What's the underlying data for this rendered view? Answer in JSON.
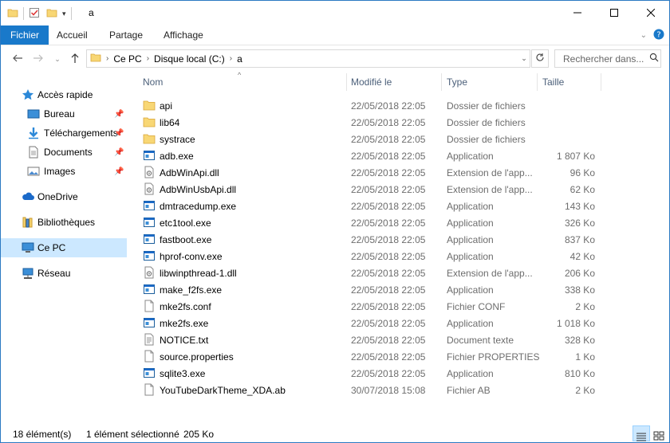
{
  "window": {
    "title": "a"
  },
  "ribbon": {
    "tabs": [
      "Fichier",
      "Accueil",
      "Partage",
      "Affichage"
    ]
  },
  "address": {
    "crumbs": [
      "Ce PC",
      "Disque local (C:)",
      "a"
    ]
  },
  "search": {
    "placeholder": "Rechercher dans..."
  },
  "sidebar": {
    "items": [
      {
        "label": "Accès rapide",
        "icon": "star-icon"
      },
      {
        "label": "Bureau",
        "icon": "desktop-icon",
        "pinned": true
      },
      {
        "label": "Téléchargements",
        "icon": "download-icon",
        "pinned": true
      },
      {
        "label": "Documents",
        "icon": "documents-icon",
        "pinned": true
      },
      {
        "label": "Images",
        "icon": "pictures-icon",
        "pinned": true
      },
      {
        "label": "OneDrive",
        "icon": "cloud-icon"
      },
      {
        "label": "Bibliothèques",
        "icon": "library-icon"
      },
      {
        "label": "Ce PC",
        "icon": "computer-icon",
        "selected": true
      },
      {
        "label": "Réseau",
        "icon": "network-icon"
      }
    ]
  },
  "columns": {
    "name": "Nom",
    "date": "Modifié le",
    "type": "Type",
    "size": "Taille"
  },
  "files": [
    {
      "name": "api",
      "date": "22/05/2018 22:05",
      "type": "Dossier de fichiers",
      "size": "",
      "icon": "folder"
    },
    {
      "name": "lib64",
      "date": "22/05/2018 22:05",
      "type": "Dossier de fichiers",
      "size": "",
      "icon": "folder"
    },
    {
      "name": "systrace",
      "date": "22/05/2018 22:05",
      "type": "Dossier de fichiers",
      "size": "",
      "icon": "folder"
    },
    {
      "name": "adb.exe",
      "date": "22/05/2018 22:05",
      "type": "Application",
      "size": "1 807 Ko",
      "icon": "exe"
    },
    {
      "name": "AdbWinApi.dll",
      "date": "22/05/2018 22:05",
      "type": "Extension de l'app...",
      "size": "96 Ko",
      "icon": "dll"
    },
    {
      "name": "AdbWinUsbApi.dll",
      "date": "22/05/2018 22:05",
      "type": "Extension de l'app...",
      "size": "62 Ko",
      "icon": "dll"
    },
    {
      "name": "dmtracedump.exe",
      "date": "22/05/2018 22:05",
      "type": "Application",
      "size": "143 Ko",
      "icon": "exe"
    },
    {
      "name": "etc1tool.exe",
      "date": "22/05/2018 22:05",
      "type": "Application",
      "size": "326 Ko",
      "icon": "exe"
    },
    {
      "name": "fastboot.exe",
      "date": "22/05/2018 22:05",
      "type": "Application",
      "size": "837 Ko",
      "icon": "exe"
    },
    {
      "name": "hprof-conv.exe",
      "date": "22/05/2018 22:05",
      "type": "Application",
      "size": "42 Ko",
      "icon": "exe"
    },
    {
      "name": "libwinpthread-1.dll",
      "date": "22/05/2018 22:05",
      "type": "Extension de l'app...",
      "size": "206 Ko",
      "icon": "dll"
    },
    {
      "name": "make_f2fs.exe",
      "date": "22/05/2018 22:05",
      "type": "Application",
      "size": "338 Ko",
      "icon": "exe"
    },
    {
      "name": "mke2fs.conf",
      "date": "22/05/2018 22:05",
      "type": "Fichier CONF",
      "size": "2 Ko",
      "icon": "file"
    },
    {
      "name": "mke2fs.exe",
      "date": "22/05/2018 22:05",
      "type": "Application",
      "size": "1 018 Ko",
      "icon": "exe"
    },
    {
      "name": "NOTICE.txt",
      "date": "22/05/2018 22:05",
      "type": "Document texte",
      "size": "328 Ko",
      "icon": "txt"
    },
    {
      "name": "source.properties",
      "date": "22/05/2018 22:05",
      "type": "Fichier PROPERTIES",
      "size": "1 Ko",
      "icon": "file"
    },
    {
      "name": "sqlite3.exe",
      "date": "22/05/2018 22:05",
      "type": "Application",
      "size": "810 Ko",
      "icon": "exe"
    },
    {
      "name": "YouTubeDarkTheme_XDA.ab",
      "date": "30/07/2018 15:08",
      "type": "Fichier AB",
      "size": "2 Ko",
      "icon": "file"
    }
  ],
  "status": {
    "count": "18 élément(s)",
    "selection": "1 élément sélectionné",
    "size": "205 Ko"
  },
  "colors": {
    "accent": "#1979ca",
    "folder": "#f8d775",
    "selected": "#cce8ff"
  }
}
